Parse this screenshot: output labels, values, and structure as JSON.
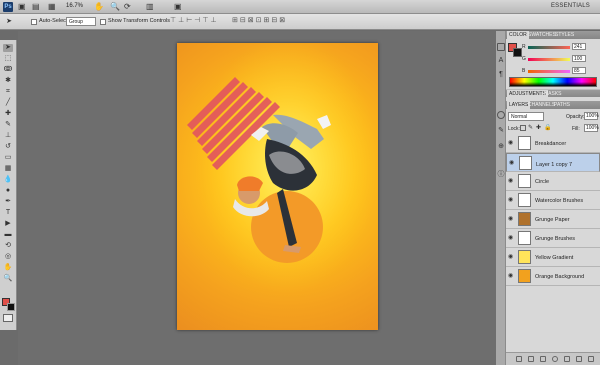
{
  "appbar": {
    "zoom": "16.7%",
    "workspace": "ESSENTIALS",
    "logo": "Ps"
  },
  "options": {
    "auto_select_label": "Auto-Select:",
    "auto_select_value": "Group",
    "transform_label": "Show Transform Controls"
  },
  "tools": [
    {
      "name": "move-tool-icon",
      "glyph": "➤"
    },
    {
      "name": "marquee-tool-icon",
      "glyph": "⬚"
    },
    {
      "name": "lasso-tool-icon",
      "glyph": "ↂ"
    },
    {
      "name": "magic-wand-tool-icon",
      "glyph": "✱"
    },
    {
      "name": "crop-tool-icon",
      "glyph": "⌗"
    },
    {
      "name": "eyedropper-tool-icon",
      "glyph": "╱"
    },
    {
      "name": "healing-brush-tool-icon",
      "glyph": "✚"
    },
    {
      "name": "brush-tool-icon",
      "glyph": "✎"
    },
    {
      "name": "clone-stamp-tool-icon",
      "glyph": "⊥"
    },
    {
      "name": "history-brush-tool-icon",
      "glyph": "↺"
    },
    {
      "name": "eraser-tool-icon",
      "glyph": "▭"
    },
    {
      "name": "gradient-tool-icon",
      "glyph": "▦"
    },
    {
      "name": "blur-tool-icon",
      "glyph": "💧"
    },
    {
      "name": "dodge-tool-icon",
      "glyph": "●"
    },
    {
      "name": "pen-tool-icon",
      "glyph": "✒"
    },
    {
      "name": "type-tool-icon",
      "glyph": "T"
    },
    {
      "name": "path-select-tool-icon",
      "glyph": "▶"
    },
    {
      "name": "shape-tool-icon",
      "glyph": "▬"
    },
    {
      "name": "3d-rotate-tool-icon",
      "glyph": "⟲"
    },
    {
      "name": "3d-orbit-tool-icon",
      "glyph": "◎"
    },
    {
      "name": "hand-tool-icon",
      "glyph": "✋"
    },
    {
      "name": "zoom-tool-icon",
      "glyph": "🔍"
    }
  ],
  "colors": {
    "foreground": "#e0504a",
    "background": "#111111",
    "accent": "#bcd0ea"
  },
  "color_panel": {
    "tabs": [
      "COLOR",
      "SWATCHES",
      "STYLES"
    ],
    "channels": [
      {
        "label": "R",
        "value": "241"
      },
      {
        "label": "G",
        "value": "100"
      },
      {
        "label": "B",
        "value": "85"
      }
    ]
  },
  "adjustments_panel": {
    "tabs": [
      "ADJUSTMENTS",
      "MASKS"
    ]
  },
  "layers_panel": {
    "tabs": [
      "LAYERS",
      "CHANNELS",
      "PATHS"
    ],
    "blend_mode": "Normal",
    "opacity_label": "Opacity:",
    "opacity_value": "100%",
    "lock_label": "Lock:",
    "fill_label": "Fill:",
    "fill_value": "100%",
    "layers": [
      {
        "name": "Breakdancer",
        "selected": false,
        "thumb": "#ffffff"
      },
      {
        "name": "Layer 1 copy 7",
        "selected": true,
        "thumb": "#ffffff"
      },
      {
        "name": "Circle",
        "selected": false,
        "thumb": "#ffffff"
      },
      {
        "name": "Watercolor Brushes",
        "selected": false,
        "thumb": "#ffffff"
      },
      {
        "name": "Grunge Paper",
        "selected": false,
        "thumb": "#b0722d"
      },
      {
        "name": "Grunge Brushes",
        "selected": false,
        "thumb": "#ffffff"
      },
      {
        "name": "Yellow Gradient",
        "selected": false,
        "thumb": "#ffe45a"
      },
      {
        "name": "Orange Background",
        "selected": false,
        "thumb": "#f2a11e"
      }
    ]
  }
}
